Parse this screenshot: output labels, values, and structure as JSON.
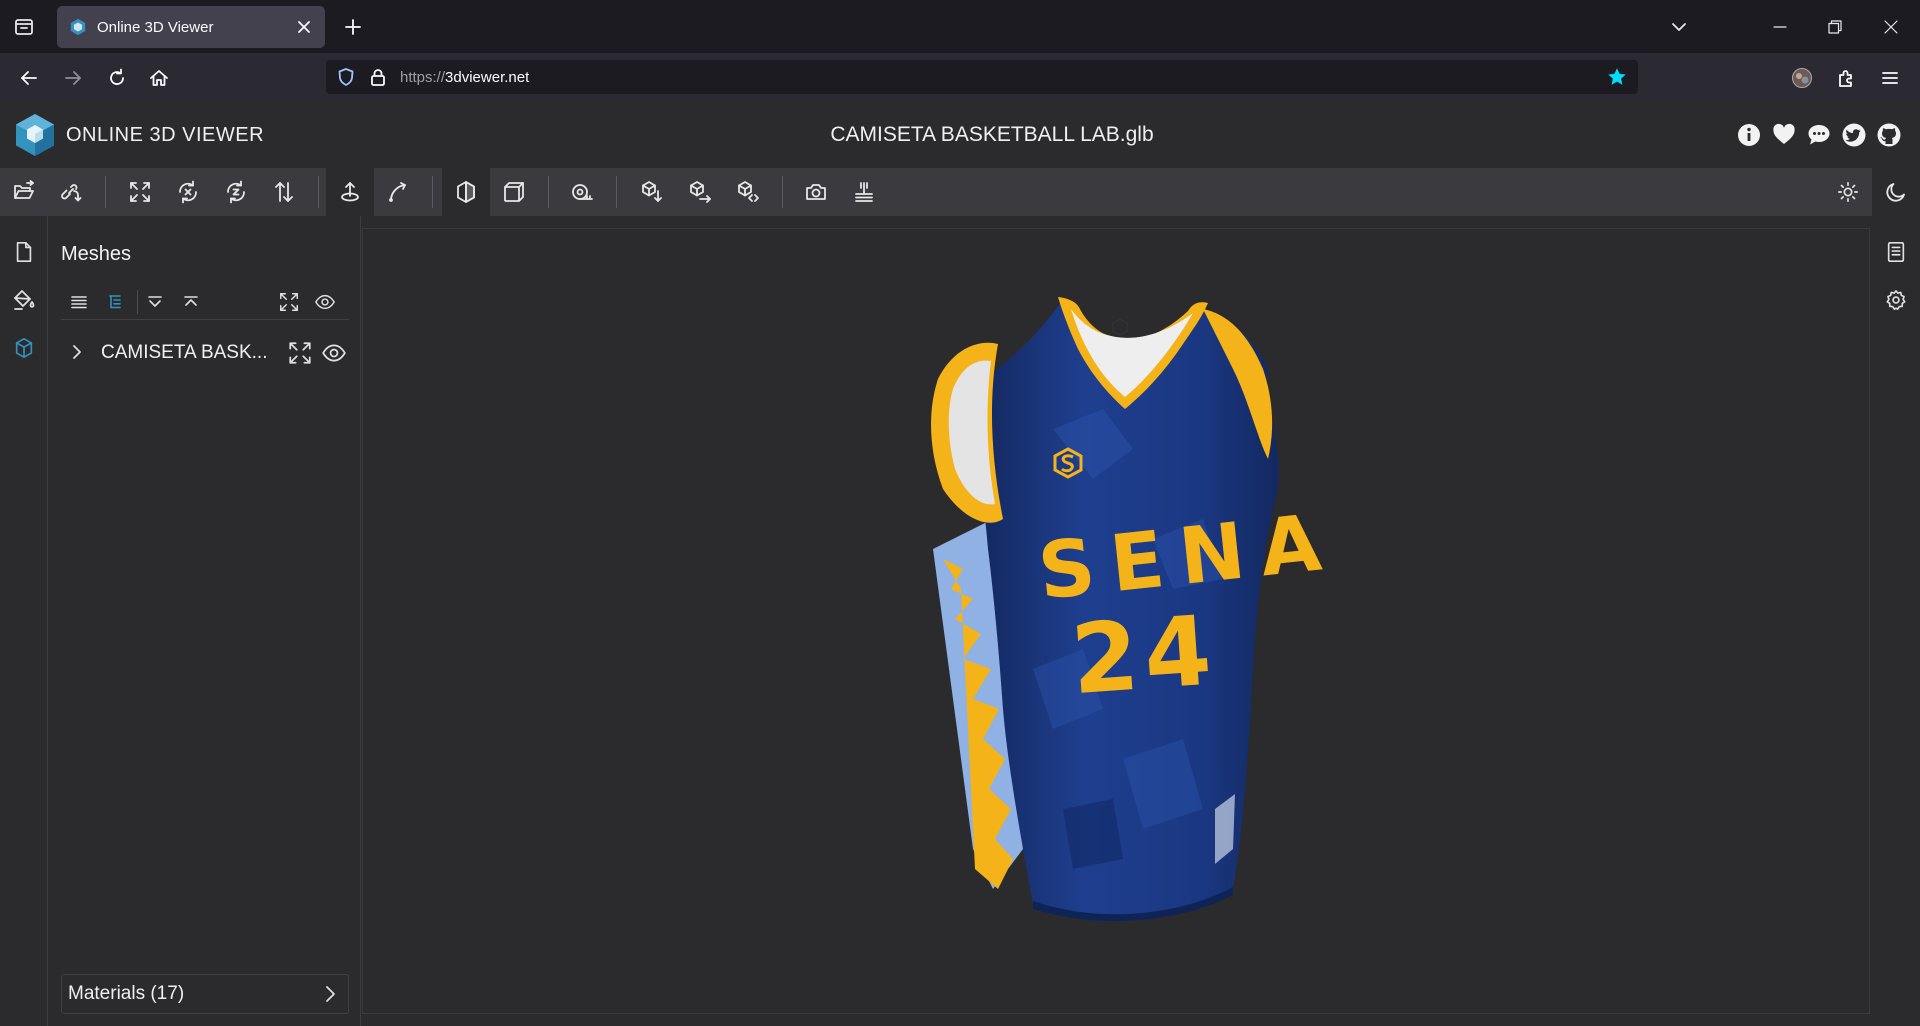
{
  "browser": {
    "tab_title": "Online 3D Viewer",
    "url_protocol": "https://",
    "url_domain": "3dviewer.net",
    "bookmark_star_color": "#0df"
  },
  "app": {
    "name": "ONLINE 3D VIEWER",
    "file_title": "CAMISETA BASKETBALL LAB.glb",
    "header_icons": [
      "info-icon",
      "heart-icon",
      "chat-icon",
      "twitter-icon",
      "github-icon"
    ],
    "accent_color": "#3393bd"
  },
  "toolbar": {
    "buttons": [
      "open-model",
      "open-url",
      "fit-to-window",
      "rotate-x",
      "rotate-z",
      "flip-up",
      "fixed-up-vector",
      "free-orbit",
      "perspective",
      "orthographic",
      "measure",
      "export-model",
      "share-model",
      "embed-model",
      "snapshot",
      "snapshot-settings",
      "light-mode",
      "dark-mode"
    ]
  },
  "meshes_panel": {
    "title": "Meshes",
    "tree_items": [
      {
        "name": "CAMISETA BASK..."
      }
    ],
    "materials_label": "Materials (17)"
  },
  "model": {
    "jersey_text": "SENA",
    "jersey_number": "24",
    "jersey_primary_color": "#1d3d8c",
    "jersey_trim_color": "#f5b31a"
  }
}
